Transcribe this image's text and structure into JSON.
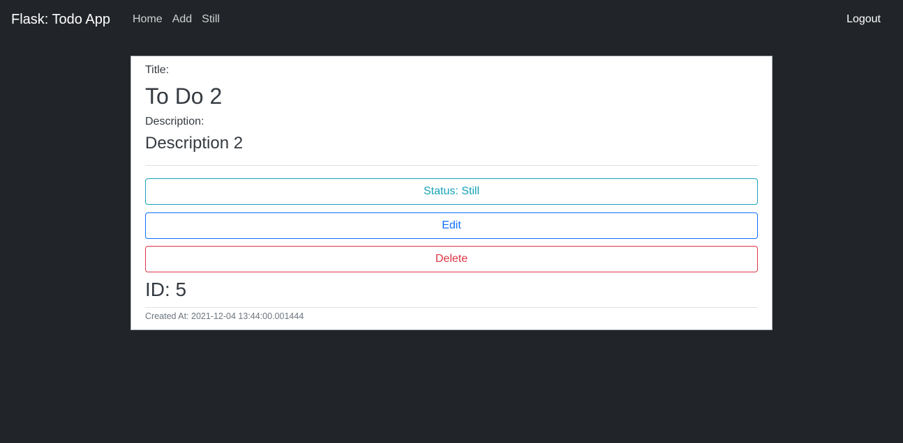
{
  "navbar": {
    "brand": "Flask: Todo App",
    "links": [
      {
        "label": "Home"
      },
      {
        "label": "Add"
      },
      {
        "label": "Still"
      }
    ],
    "logout_label": "Logout"
  },
  "todo": {
    "title_label": "Title:",
    "title": "To Do 2",
    "description_label": "Description:",
    "description": "Description 2",
    "status_button": "Status: Still",
    "edit_button": "Edit",
    "delete_button": "Delete",
    "id_text": "ID: 5",
    "created_at": "Created At: 2021-12-04 13:44:00.001444"
  },
  "colors": {
    "background": "#212529",
    "status": "#17a2b8",
    "edit": "#0d6efd",
    "delete": "#dc3545"
  }
}
